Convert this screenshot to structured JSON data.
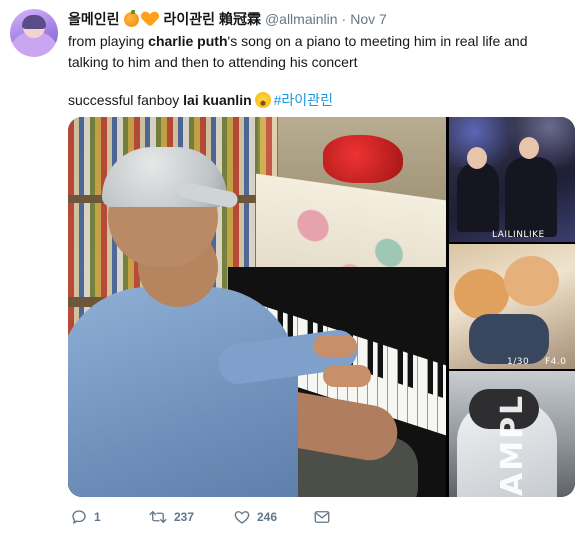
{
  "author": {
    "name": "올메인린",
    "name_suffix": "라이관린 賴冠霖",
    "handle": "@allmainlin",
    "separator": "·",
    "date": "Nov 7",
    "icons": [
      "orange-emoji-icon",
      "orange-heart-icon"
    ]
  },
  "tweet": {
    "line1": {
      "pre": "from playing ",
      "bold1": "charlie puth",
      "mid": "'s song on a piano to meeting him in real life and"
    },
    "line2": "talking to him and then to attending his concert",
    "line3": {
      "pre": "successful fanboy ",
      "bold": "lai kuanlin",
      "emoji": "face-with-tears-of-joy-icon",
      "hashtag": "#라이관린"
    }
  },
  "media": {
    "thumb1_caption": "LAILINLIKE",
    "thumb2_caption_left": "1/30",
    "thumb2_caption_right": "F4.0",
    "thumb3_watermark": "AMPL"
  },
  "actions": {
    "reply_count": "1",
    "retweet_count": "237",
    "like_count": "246"
  },
  "colors": {
    "text": "#14171a",
    "muted": "#657786",
    "link": "#1b95e0"
  }
}
